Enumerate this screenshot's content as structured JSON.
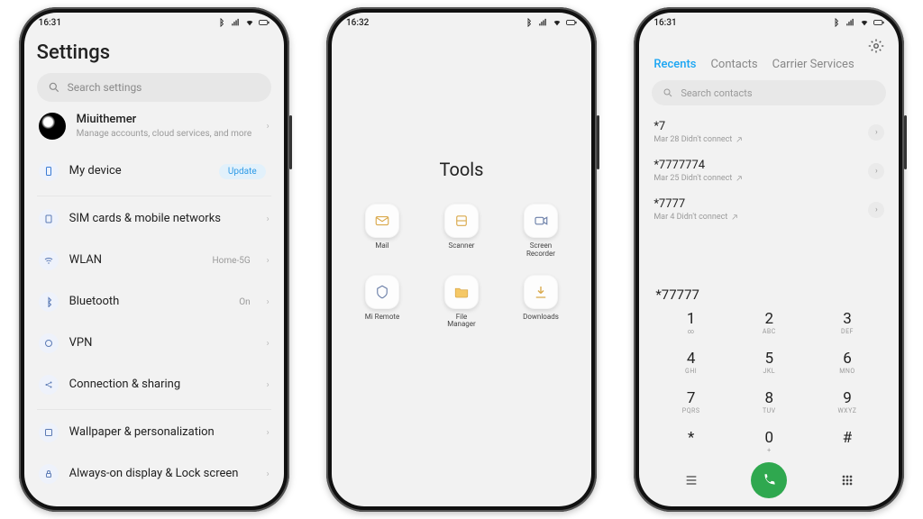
{
  "status": {
    "time1": "16:31",
    "time2": "16:32",
    "time3": "16:31"
  },
  "settings": {
    "title": "Settings",
    "search_placeholder": "Search settings",
    "account": {
      "name": "Miuithemer",
      "sub": "Manage accounts, cloud services, and more"
    },
    "mydevice": {
      "label": "My device",
      "badge": "Update"
    },
    "items": [
      {
        "label": "SIM cards & mobile networks",
        "tail": ""
      },
      {
        "label": "WLAN",
        "tail": "Home-5G"
      },
      {
        "label": "Bluetooth",
        "tail": "On"
      },
      {
        "label": "VPN",
        "tail": ""
      },
      {
        "label": "Connection & sharing",
        "tail": ""
      }
    ],
    "items2": [
      {
        "label": "Wallpaper & personalization",
        "tail": ""
      },
      {
        "label": "Always-on display & Lock screen",
        "tail": ""
      }
    ]
  },
  "tools": {
    "title": "Tools",
    "apps": [
      {
        "label": "Mail"
      },
      {
        "label": "Scanner"
      },
      {
        "label": "Screen\nRecorder"
      },
      {
        "label": "Mi Remote"
      },
      {
        "label": "File\nManager"
      },
      {
        "label": "Downloads"
      }
    ]
  },
  "dialer": {
    "tabs": {
      "recents": "Recents",
      "contacts": "Contacts",
      "carrier": "Carrier Services"
    },
    "search_placeholder": "Search contacts",
    "calls": [
      {
        "num": "*7",
        "meta": "Mar 28 Didn't connect"
      },
      {
        "num": "*7777774",
        "meta": "Mar 25 Didn't connect"
      },
      {
        "num": "*7777",
        "meta": "Mar 4 Didn't connect"
      }
    ],
    "display": "*77777",
    "keys": [
      {
        "d": "1",
        "l": "∞"
      },
      {
        "d": "2",
        "l": "ABC"
      },
      {
        "d": "3",
        "l": "DEF"
      },
      {
        "d": "4",
        "l": "GHI"
      },
      {
        "d": "5",
        "l": "JKL"
      },
      {
        "d": "6",
        "l": "MNO"
      },
      {
        "d": "7",
        "l": "PQRS"
      },
      {
        "d": "8",
        "l": "TUV"
      },
      {
        "d": "9",
        "l": "WXYZ"
      },
      {
        "d": "*",
        "l": ""
      },
      {
        "d": "0",
        "l": "+"
      },
      {
        "d": "#",
        "l": ""
      }
    ]
  }
}
